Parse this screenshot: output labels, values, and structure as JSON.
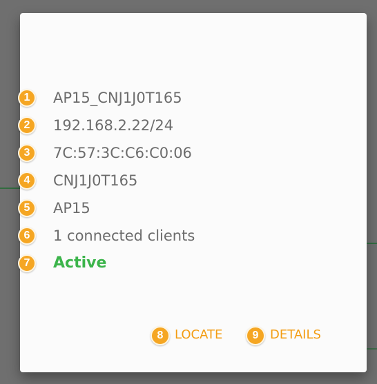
{
  "card": {
    "rows": [
      {
        "index": "1",
        "text": "AP15_CNJ1J0T165",
        "kind": "name"
      },
      {
        "index": "2",
        "text": "192.168.2.22/24",
        "kind": "ip"
      },
      {
        "index": "3",
        "text": "7C:57:3C:C6:C0:06",
        "kind": "mac"
      },
      {
        "index": "4",
        "text": "CNJ1J0T165",
        "kind": "serial"
      },
      {
        "index": "5",
        "text": "AP15",
        "kind": "model"
      },
      {
        "index": "6",
        "text": "1 connected clients",
        "kind": "clients"
      },
      {
        "index": "7",
        "text": "Active",
        "kind": "status"
      }
    ],
    "actions": {
      "locate": {
        "index": "8",
        "label": "LOCATE"
      },
      "details": {
        "index": "9",
        "label": "DETAILS"
      }
    }
  },
  "colors": {
    "badge": "#f5a623",
    "action": "#f39c12",
    "status_active": "#3bb44a",
    "text": "#6c6c6c",
    "backdrop": "#6f6f6f"
  }
}
